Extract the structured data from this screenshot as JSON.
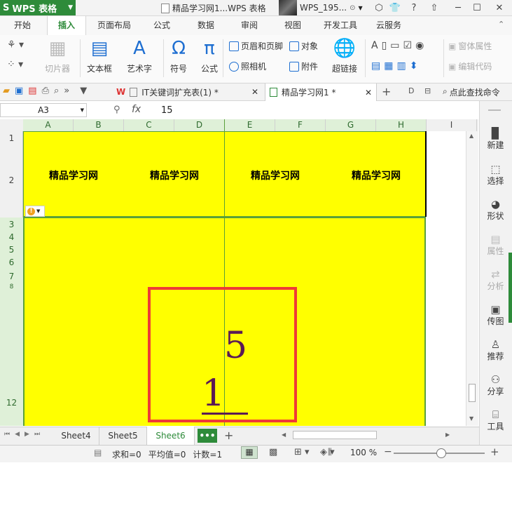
{
  "app": {
    "name": "WPS 表格",
    "logo": "S"
  },
  "window": {
    "title": "精品学习网1...WPS 表格",
    "user": "WPS_195..."
  },
  "menu_tabs": [
    "开始",
    "插入",
    "页面布局",
    "公式",
    "数据",
    "审阅",
    "视图",
    "开发工具",
    "云服务"
  ],
  "active_menu_tab": "插入",
  "ribbon": {
    "slicer": "切片器",
    "textbox": "文本框",
    "wordart": "艺术字",
    "symbol": "符号",
    "formula": "公式",
    "header_footer": "页眉和页脚",
    "object": "对象",
    "camera": "照相机",
    "attachment": "附件",
    "hyperlink": "超链接",
    "control_properties": "窗体属性",
    "edit_code": "编辑代码"
  },
  "doc_tabs": [
    {
      "label": "IT关键词扩充表(1) *",
      "active": false
    },
    {
      "label": "精品学习网1 *",
      "active": true
    }
  ],
  "search_cmd": "点此查找命令",
  "formula_bar": {
    "cell_ref": "A3",
    "fx": "fx",
    "value": "15"
  },
  "columns": [
    "A",
    "B",
    "C",
    "D",
    "E",
    "F",
    "G",
    "H",
    "I"
  ],
  "rows": [
    "1",
    "2",
    "3",
    "4",
    "5",
    "6",
    "7",
    "8",
    "12"
  ],
  "header_cells": [
    "精品学习网",
    "精品学习网",
    "精品学习网",
    "精品学习网"
  ],
  "fraction": {
    "numerator": "5",
    "denominator": "1"
  },
  "side_panel": [
    {
      "label": "新建",
      "icon": "new-icon",
      "enabled": true
    },
    {
      "label": "选择",
      "icon": "select-icon",
      "enabled": true
    },
    {
      "label": "形状",
      "icon": "shape-icon",
      "enabled": true
    },
    {
      "label": "属性",
      "icon": "properties-icon",
      "enabled": false
    },
    {
      "label": "分析",
      "icon": "analyze-icon",
      "enabled": false
    },
    {
      "label": "传图",
      "icon": "upload-image-icon",
      "enabled": true
    },
    {
      "label": "推荐",
      "icon": "recommend-icon",
      "enabled": true
    },
    {
      "label": "分享",
      "icon": "share-icon",
      "enabled": true
    },
    {
      "label": "工具",
      "icon": "tools-icon",
      "enabled": true
    }
  ],
  "sheet_tabs": [
    {
      "label": "Sheet4",
      "active": false
    },
    {
      "label": "Sheet5",
      "active": false
    },
    {
      "label": "Sheet6",
      "active": true
    }
  ],
  "more_tabs": "•••",
  "status": {
    "sum": "求和=0",
    "avg": "平均值=0",
    "count": "计数=1",
    "zoom": "100 %"
  },
  "colors": {
    "brand": "#2e8b3a",
    "cell_fill": "#ffff00",
    "box_border": "#ef3b36",
    "math_text": "#5a1a55"
  }
}
